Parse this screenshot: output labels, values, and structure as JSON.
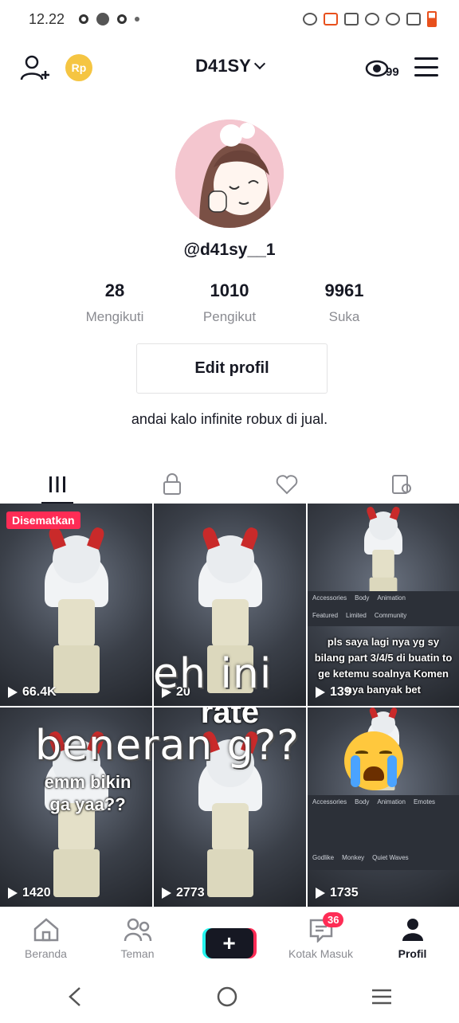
{
  "status_bar": {
    "time": "12.22"
  },
  "header": {
    "username": "D41SY",
    "coin_label": "Rp",
    "eye_count": "99"
  },
  "profile": {
    "handle": "@d41sy__1",
    "stats": [
      {
        "value": "28",
        "label": "Mengikuti"
      },
      {
        "value": "1010",
        "label": "Pengikut"
      },
      {
        "value": "9961",
        "label": "Suka"
      }
    ],
    "edit_button": "Edit profil",
    "bio": "andai kalo infinite robux di jual."
  },
  "tabs": [
    "videos-icon",
    "lock-icon",
    "heart-icon",
    "tagged-icon"
  ],
  "grid": {
    "pinned_label": "Disematkan",
    "videos": [
      {
        "views": "66.4K"
      },
      {
        "views": "20"
      },
      {
        "views": "139",
        "caption": "pls saya lagi nya yg sy bilang part 3/4/5 di buatin to ge ketemu soalnya Komen nya banyak bet"
      },
      {
        "views": "1420",
        "caption": "emm bikin ga yaa??"
      },
      {
        "views": "2773",
        "caption": "rate"
      },
      {
        "views": "1735"
      }
    ],
    "ui_strip_top": [
      "Accessories",
      "Body",
      "Animation"
    ],
    "ui_strip_sub": [
      "Featured",
      "Limited",
      "Community"
    ],
    "ui_strip_bottom": [
      "Accessories",
      "Body",
      "Animation",
      "Emotes"
    ],
    "ui_strip_bottom_items": [
      "Godlike",
      "Monkey",
      "Quiet Waves"
    ]
  },
  "overlay": {
    "line1": "eh ini",
    "line2": "beneran g??"
  },
  "bottom_nav": {
    "items": [
      {
        "label": "Beranda"
      },
      {
        "label": "Teman"
      },
      {
        "label": "+"
      },
      {
        "label": "Kotak Masuk",
        "badge": "36"
      },
      {
        "label": "Profil"
      }
    ]
  },
  "colors": {
    "accent": "#fe2c55",
    "cyan": "#25f4ee",
    "text": "#161823",
    "muted": "#8a8b91"
  }
}
